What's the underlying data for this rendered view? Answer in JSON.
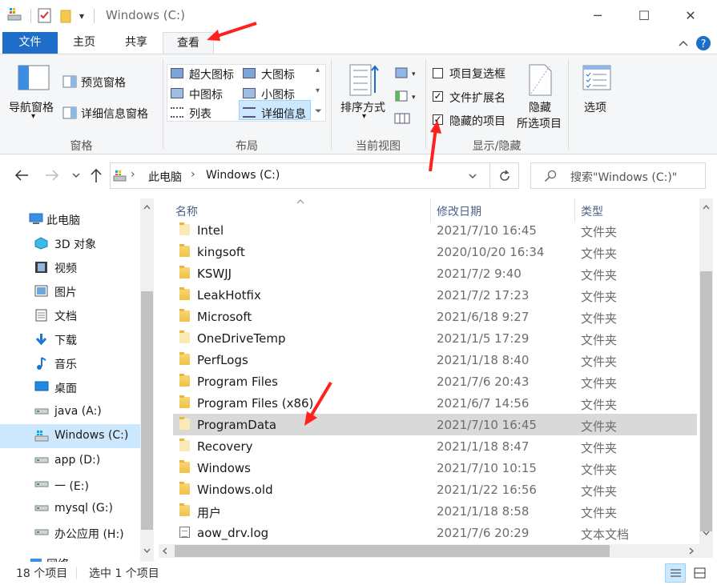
{
  "window": {
    "title": "Windows (C:)",
    "controls": {
      "minimize": "─",
      "maximize": "☐",
      "close": "✕"
    },
    "qat_dropdown": "▾"
  },
  "tabs": [
    {
      "label": "文件"
    },
    {
      "label": "主页"
    },
    {
      "label": "共享"
    },
    {
      "label": "查看"
    }
  ],
  "ribbon": {
    "panes": {
      "label": "窗格",
      "nav_pane": "导航窗格",
      "preview_pane": "预览窗格",
      "details_pane": "详细信息窗格"
    },
    "layout": {
      "label": "布局",
      "items": [
        "超大图标",
        "大图标",
        "中图标",
        "小图标",
        "列表",
        "详细信息"
      ]
    },
    "current_view": {
      "label": "当前视图",
      "sort_by": "排序方式"
    },
    "show_hide": {
      "label": "显示/隐藏",
      "item_checkboxes": {
        "label": "项目复选框",
        "checked": false
      },
      "file_extensions": {
        "label": "文件扩展名",
        "checked": true
      },
      "hidden_items": {
        "label": "隐藏的项目",
        "checked": true
      },
      "hide_selected_line1": "隐藏",
      "hide_selected_line2": "所选项目"
    },
    "options": "选项"
  },
  "address": {
    "breadcrumb": [
      "此电脑",
      "Windows (C:)"
    ],
    "separator": "›",
    "search_placeholder": "搜索\"Windows (C:)\""
  },
  "nav_pane": {
    "items": [
      {
        "label": "此电脑",
        "icon": "computer-icon"
      },
      {
        "label": "3D 对象",
        "icon": "3d-objects-icon"
      },
      {
        "label": "视频",
        "icon": "video-icon"
      },
      {
        "label": "图片",
        "icon": "pictures-icon"
      },
      {
        "label": "文档",
        "icon": "documents-icon"
      },
      {
        "label": "下载",
        "icon": "download-icon"
      },
      {
        "label": "音乐",
        "icon": "music-icon"
      },
      {
        "label": "桌面",
        "icon": "desktop-icon"
      },
      {
        "label": "java (A:)",
        "icon": "drive-icon"
      },
      {
        "label": "Windows (C:)",
        "icon": "windows-drive-icon"
      },
      {
        "label": "app (D:)",
        "icon": "drive-icon"
      },
      {
        "label": "一 (E:)",
        "icon": "drive-icon"
      },
      {
        "label": "mysql (G:)",
        "icon": "drive-icon"
      },
      {
        "label": "办公应用 (H:)",
        "icon": "drive-icon"
      },
      {
        "label": "网络",
        "icon": "network-icon"
      }
    ]
  },
  "file_list": {
    "columns": [
      "名称",
      "修改日期",
      "类型"
    ],
    "rows": [
      {
        "name": "Intel",
        "date": "2021/7/10 16:45",
        "type": "文件夹",
        "icon": "folder-icon"
      },
      {
        "name": "kingsoft",
        "date": "2020/10/20 16:34",
        "type": "文件夹",
        "icon": "folder-icon"
      },
      {
        "name": "KSWJJ",
        "date": "2021/7/2 9:40",
        "type": "文件夹",
        "icon": "folder-icon"
      },
      {
        "name": "LeakHotfix",
        "date": "2021/7/2 17:23",
        "type": "文件夹",
        "icon": "folder-icon"
      },
      {
        "name": "Microsoft",
        "date": "2021/6/18 9:27",
        "type": "文件夹",
        "icon": "folder-icon"
      },
      {
        "name": "OneDriveTemp",
        "date": "2021/1/5 17:29",
        "type": "文件夹",
        "icon": "folder-icon"
      },
      {
        "name": "PerfLogs",
        "date": "2021/1/18 8:40",
        "type": "文件夹",
        "icon": "folder-icon"
      },
      {
        "name": "Program Files",
        "date": "2021/7/6 20:43",
        "type": "文件夹",
        "icon": "folder-icon"
      },
      {
        "name": "Program Files (x86)",
        "date": "2021/6/7 14:56",
        "type": "文件夹",
        "icon": "folder-icon"
      },
      {
        "name": "ProgramData",
        "date": "2021/7/10 16:45",
        "type": "文件夹",
        "icon": "folder-icon",
        "selected": true
      },
      {
        "name": "Recovery",
        "date": "2021/1/18 8:47",
        "type": "文件夹",
        "icon": "folder-icon"
      },
      {
        "name": "Windows",
        "date": "2021/7/10 10:15",
        "type": "文件夹",
        "icon": "folder-icon"
      },
      {
        "name": "Windows.old",
        "date": "2021/1/22 16:56",
        "type": "文件夹",
        "icon": "folder-icon"
      },
      {
        "name": "用户",
        "date": "2021/1/18 8:58",
        "type": "文件夹",
        "icon": "folder-icon"
      },
      {
        "name": "aow_drv.log",
        "date": "2021/7/6 20:29",
        "type": "文本文档",
        "icon": "text-file-icon"
      }
    ]
  },
  "status": {
    "item_count": "18 个项目",
    "selected": "选中 1 个项目"
  },
  "colors": {
    "file_tab": "#1e6ec9",
    "selection": "#d9d9d9",
    "nav_selection": "#cce8ff",
    "annotation_arrow": "#ff2020"
  }
}
